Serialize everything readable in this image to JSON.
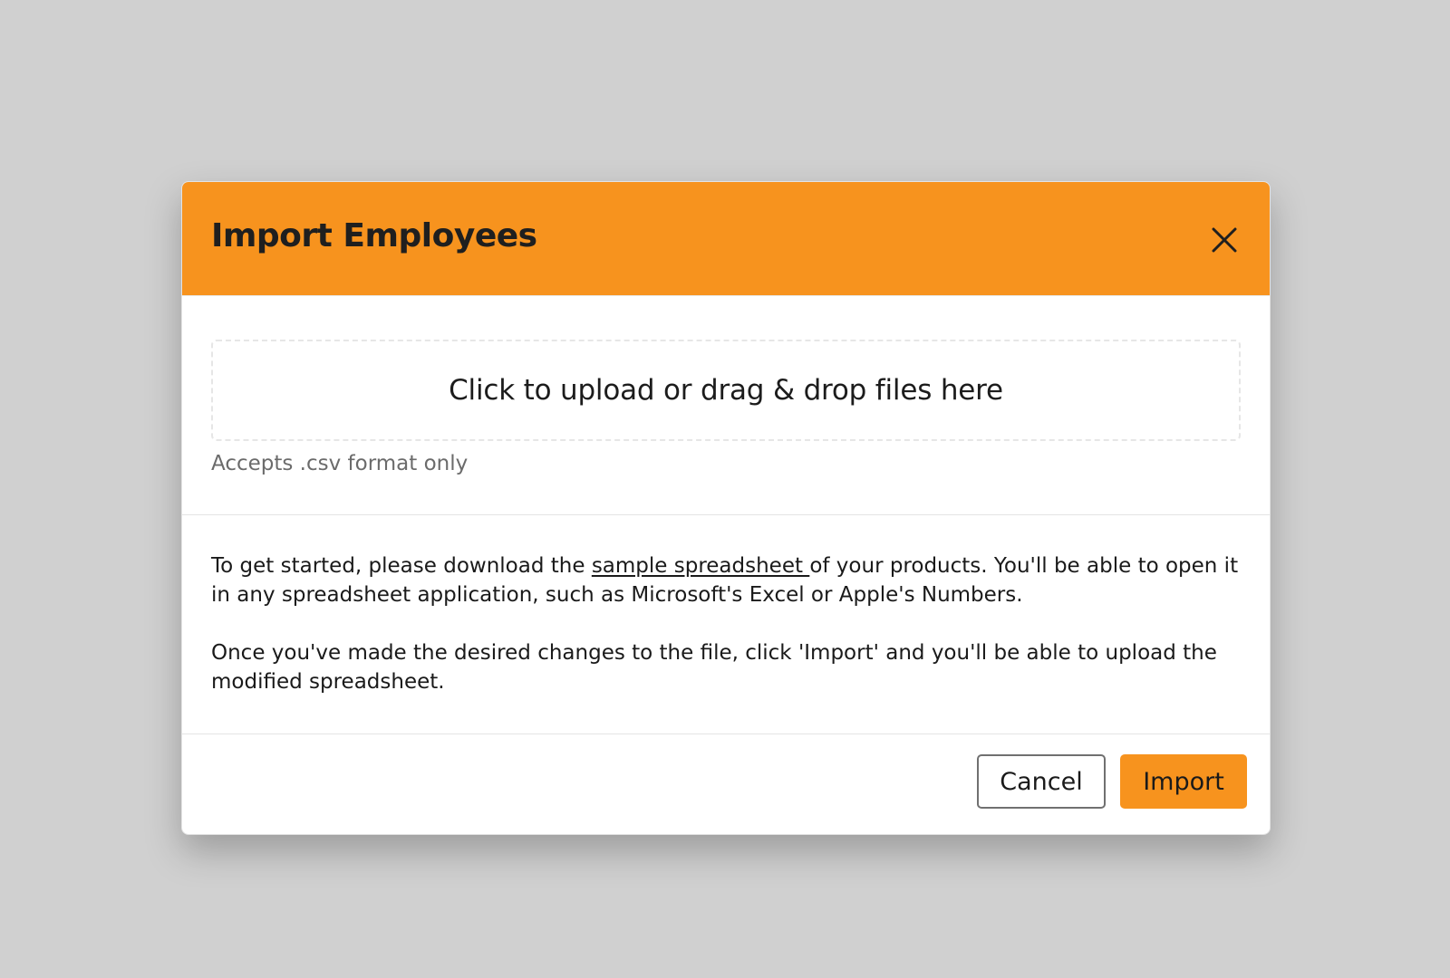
{
  "theme": {
    "accent": "#f7931e",
    "backdrop": "#d0d0d0"
  },
  "modal": {
    "title": "Import Employees",
    "close_icon": "close-icon"
  },
  "upload": {
    "dropzone_text": "Click to upload or drag & drop files here",
    "hint": "Accepts .csv format only"
  },
  "instructions": {
    "p1_before": "To get started, please download the ",
    "p1_link": "sample spreadsheet ",
    "p1_after": "of your products. You'll be able to open it in any spreadsheet application, such as Microsoft's Excel or Apple's Numbers.",
    "p2": "Once you've made the desired changes to the file, click 'Import' and you'll be able to upload the modified spreadsheet."
  },
  "footer": {
    "cancel_label": "Cancel",
    "import_label": "Import"
  }
}
